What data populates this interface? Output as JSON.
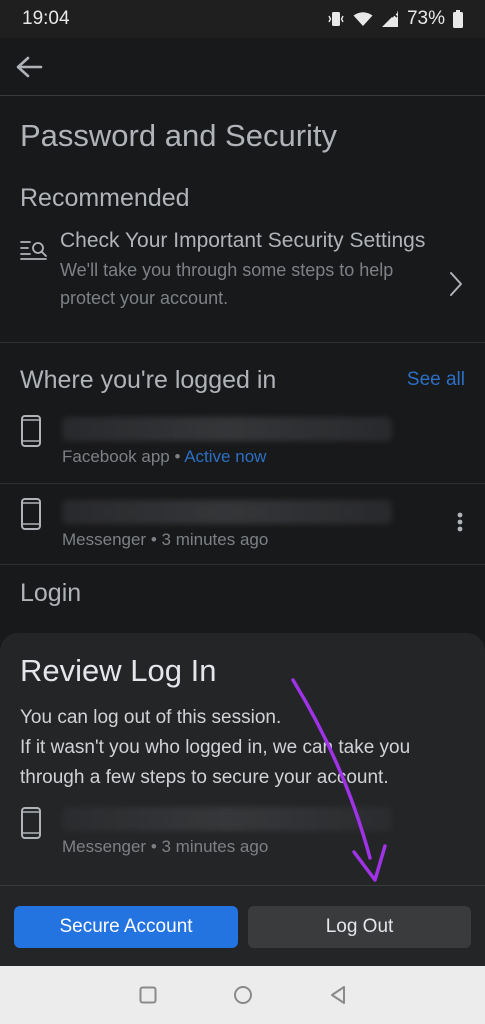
{
  "status": {
    "time": "19:04",
    "battery": "73%"
  },
  "header": {
    "back_icon": "arrow-left-icon"
  },
  "page": {
    "title": "Password and Security"
  },
  "recommended": {
    "title": "Recommended",
    "item": {
      "title": "Check Your Important Security Settings",
      "description": "We'll take you through some steps to help protect your account."
    }
  },
  "logged_in": {
    "title": "Where you're logged in",
    "see_all": "See all",
    "sessions": [
      {
        "app": "Facebook app",
        "separator": " • ",
        "status": "Active now"
      },
      {
        "app": "Messenger",
        "separator": " • ",
        "status": "3 minutes ago"
      }
    ]
  },
  "login": {
    "title": "Login"
  },
  "sheet": {
    "title": "Review Log In",
    "line1": "You can log out of this session.",
    "line2": "If it wasn't you who logged in, we can take you through a few steps to secure your account.",
    "device_meta": "Messenger • 3 minutes ago",
    "secure_button": "Secure Account",
    "logout_button": "Log Out"
  },
  "colors": {
    "accent": "#2374e1",
    "link": "#2d6fc4",
    "annotation_arrow": "#a033e8"
  }
}
